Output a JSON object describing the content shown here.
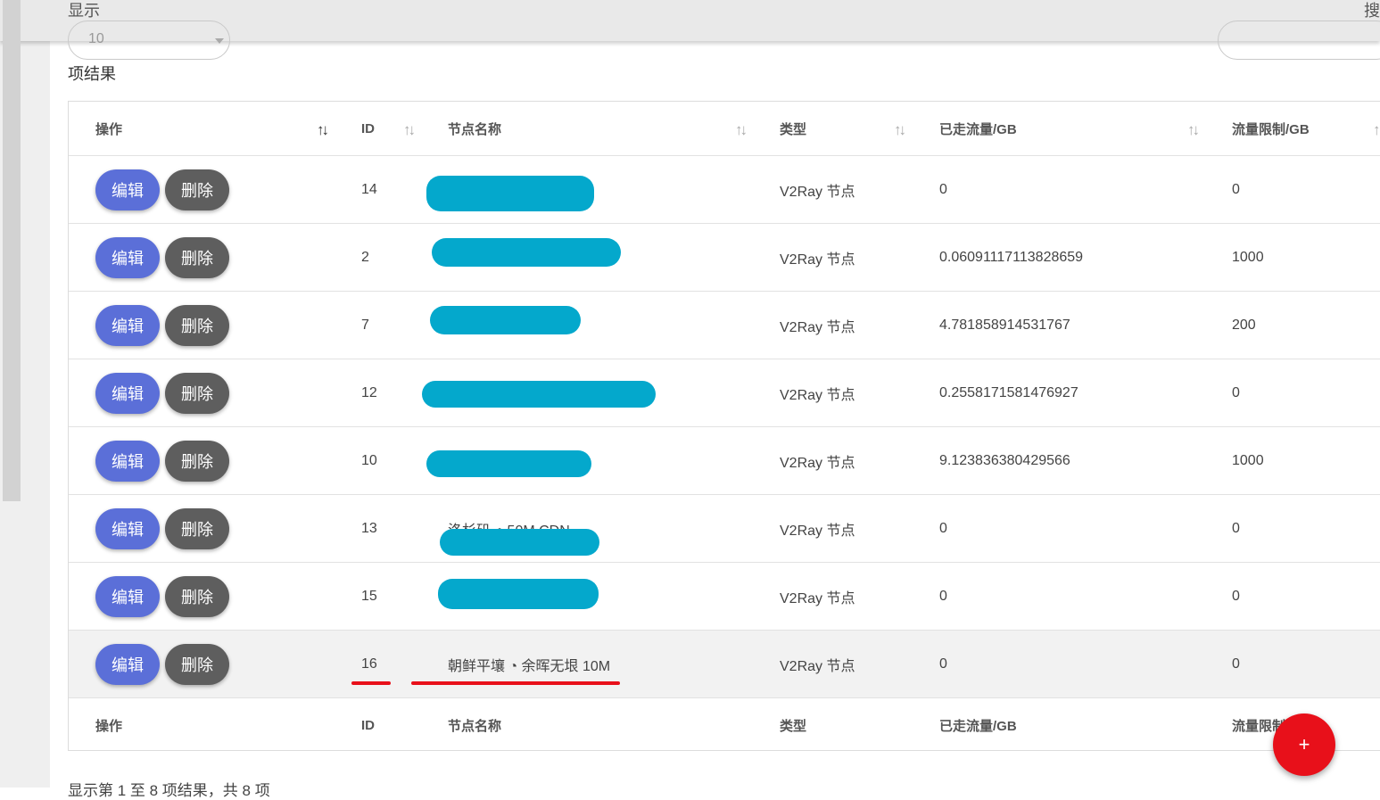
{
  "controls": {
    "show_label": "显示",
    "page_length": "10",
    "search_label": "搜",
    "result_suffix": "项结果"
  },
  "columns": [
    "操作",
    "ID",
    "节点名称",
    "类型",
    "已走流量/GB",
    "流量限制/GB"
  ],
  "footer_columns": [
    "操作",
    "ID",
    "节点名称",
    "类型",
    "已走流量/GB",
    "流量限制"
  ],
  "actions": {
    "edit": "编辑",
    "delete": "删除"
  },
  "rows": [
    {
      "id": "14",
      "name": "",
      "type": "V2Ray 节点",
      "used": "0",
      "limit": "0"
    },
    {
      "id": "2",
      "name": "",
      "type": "V2Ray 节点",
      "used": "0.06091117113828659",
      "limit": "1000"
    },
    {
      "id": "7",
      "name": "",
      "type": "V2Ray 节点",
      "used": "4.781858914531767",
      "limit": "200"
    },
    {
      "id": "12",
      "name": "",
      "type": "V2Ray 节点",
      "used": "0.2558171581476927",
      "limit": "0"
    },
    {
      "id": "10",
      "name": "",
      "type": "V2Ray 节点",
      "used": "9.123836380429566",
      "limit": "1000"
    },
    {
      "id": "13",
      "name": "洛杉矶 ◔ 50M CDN",
      "type": "V2Ray 节点",
      "used": "0",
      "limit": "0"
    },
    {
      "id": "15",
      "name": "",
      "type": "V2Ray 节点",
      "used": "0",
      "limit": "0"
    },
    {
      "id": "16",
      "name": "朝鲜平壤 ◔ 余晖无垠 10M",
      "type": "V2Ray 节点",
      "used": "0",
      "limit": "0"
    }
  ],
  "info_bottom": "显示第 1 至 8 项结果，共 8 项",
  "fab_label": "+",
  "colors": {
    "edit": "#5b6fd8",
    "delete": "#5e5e5e",
    "redact": "#04a8cc",
    "fab": "#e8101a",
    "underline": "#e8101a"
  }
}
